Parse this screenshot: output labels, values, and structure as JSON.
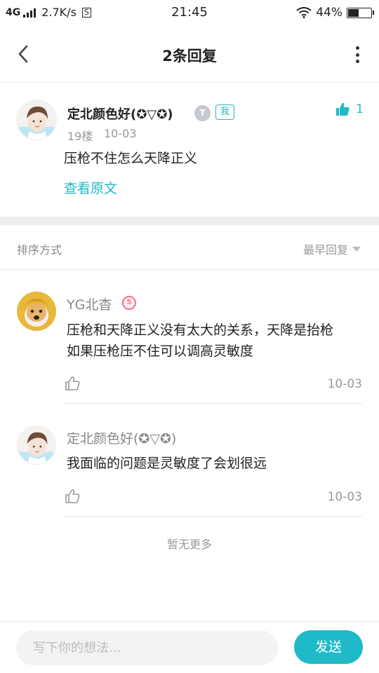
{
  "status_bar": {
    "network": "4G",
    "speed": "2.7K/s",
    "sim_icon": "S",
    "time": "21:45",
    "battery": "44%",
    "battery_level": 0.44
  },
  "nav": {
    "title": "2条回复",
    "back_icon": "chevron-left",
    "more_icon": "vertical-dots"
  },
  "main_comment": {
    "user": "定北颜色好(✪▽✪)",
    "badge_t": "T",
    "badge_me": "我",
    "likes": "1",
    "floor": "19楼",
    "date": "10-03",
    "text": "压枪不住怎么天降正义",
    "view_original": "查看原文"
  },
  "sort": {
    "label": "排序方式",
    "value": "最早回复"
  },
  "replies": [
    {
      "user": "YG北杳",
      "level": "5",
      "text_line1": "压枪和天降正义没有太大的关系，天降是抬枪",
      "text_line2": "如果压枪压不住可以调高灵敏度",
      "date": "10-03"
    },
    {
      "user": "定北颜色好(✪▽✪)",
      "text_line1": "我面临的问题是灵敏度了会划很远",
      "date": "10-03"
    }
  ],
  "no_more": "暂无更多",
  "input": {
    "placeholder": "写下你的想法..."
  },
  "send_button": "发送",
  "colors": {
    "accent": "#1fb9c7",
    "level_badge": "#ff6e8c"
  }
}
